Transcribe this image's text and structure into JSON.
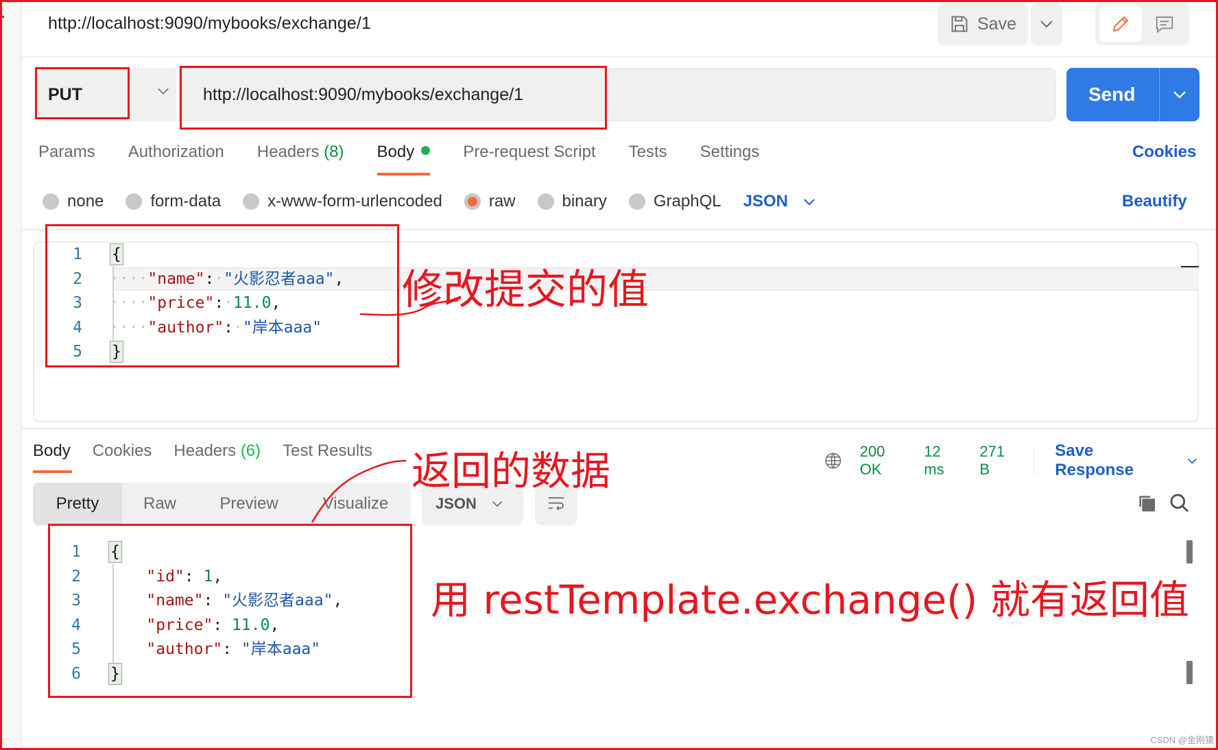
{
  "header": {
    "title": "http://localhost:9090/mybooks/exchange/1",
    "save_label": "Save"
  },
  "request": {
    "method": "PUT",
    "url": "http://localhost:9090/mybooks/exchange/1",
    "send_label": "Send"
  },
  "request_tabs": {
    "params": "Params",
    "authorization": "Authorization",
    "headers": "Headers",
    "headers_count": "(8)",
    "body": "Body",
    "prerequest": "Pre-request Script",
    "tests": "Tests",
    "settings": "Settings",
    "cookies": "Cookies"
  },
  "body_types": {
    "none": "none",
    "form_data": "form-data",
    "urlencoded": "x-www-form-urlencoded",
    "raw": "raw",
    "binary": "binary",
    "graphql": "GraphQL",
    "selected": "raw",
    "language": "JSON",
    "beautify": "Beautify"
  },
  "request_body": {
    "line_numbers": [
      "1",
      "2",
      "3",
      "4",
      "5"
    ],
    "open_brace": "{",
    "close_brace": "}",
    "lines": [
      {
        "key": "\"name\"",
        "value": "\"火影忍者aaa\"",
        "value_type": "string",
        "trail": ","
      },
      {
        "key": "\"price\"",
        "value": "11.0",
        "value_type": "number",
        "trail": ","
      },
      {
        "key": "\"author\"",
        "value": "\"岸本aaa\"",
        "value_type": "string",
        "trail": ""
      }
    ]
  },
  "response_tabs": {
    "body": "Body",
    "cookies": "Cookies",
    "headers": "Headers",
    "headers_count": "(6)",
    "test_results": "Test Results"
  },
  "response_meta": {
    "status": "200 OK",
    "time": "12 ms",
    "size": "271 B",
    "save_response": "Save Response"
  },
  "response_view": {
    "modes": [
      "Pretty",
      "Raw",
      "Preview",
      "Visualize"
    ],
    "active_mode": "Pretty",
    "format": "JSON"
  },
  "response_body": {
    "line_numbers": [
      "1",
      "2",
      "3",
      "4",
      "5",
      "6"
    ],
    "open_brace": "{",
    "close_brace": "}",
    "lines": [
      {
        "key": "\"id\"",
        "value": "1",
        "value_type": "number",
        "trail": ","
      },
      {
        "key": "\"name\"",
        "value": "\"火影忍者aaa\"",
        "value_type": "string",
        "trail": ","
      },
      {
        "key": "\"price\"",
        "value": "11.0",
        "value_type": "number",
        "trail": ","
      },
      {
        "key": "\"author\"",
        "value": "\"岸本aaa\"",
        "value_type": "string",
        "trail": ""
      }
    ]
  },
  "annotations": {
    "modify_values": "修改提交的值",
    "returned_data": "返回的数据",
    "exchange_note": "用 restTemplate.exchange() 就有返回值"
  },
  "watermark": "CSDN @金刚猿",
  "colors": {
    "accent_orange": "#f26b3a",
    "send_blue": "#2f7ae5",
    "link_blue": "#1f5ec9",
    "status_green": "#0e8a4a",
    "annotation_red": "#e8161f"
  }
}
